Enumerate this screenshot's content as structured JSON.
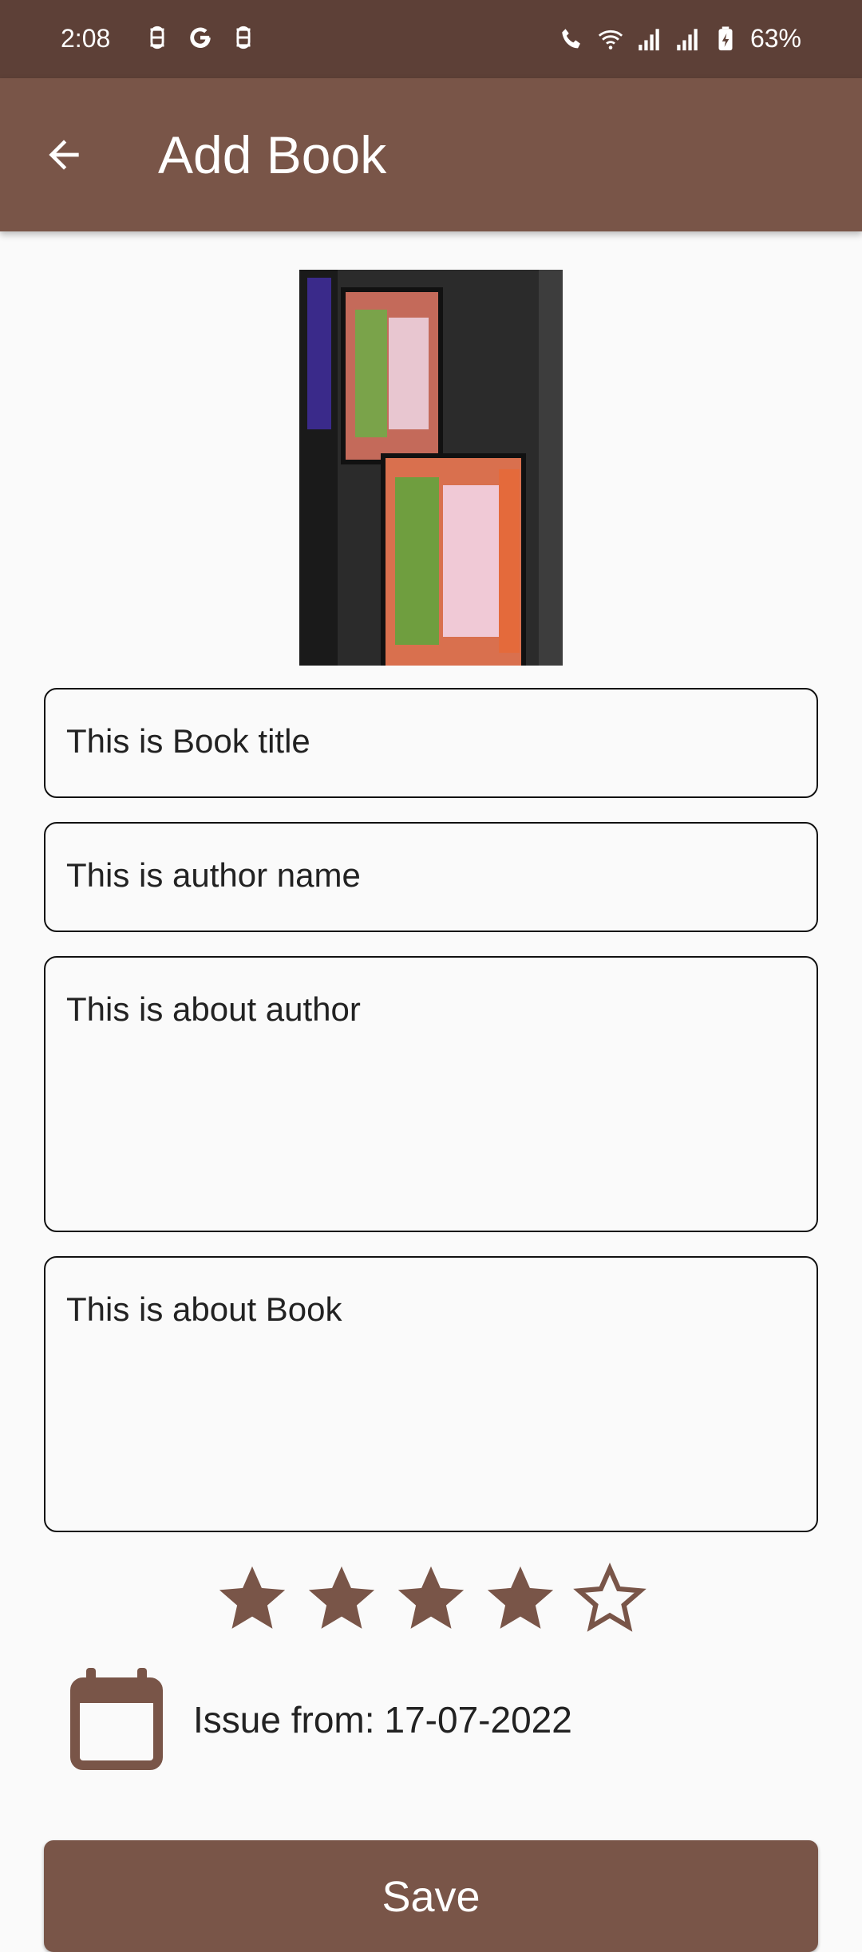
{
  "status_bar": {
    "time": "2:08",
    "battery": "63%",
    "icons": [
      "notification-icon",
      "google-icon",
      "notification-icon",
      "wifi-calling-icon",
      "wifi-icon",
      "signal-icon",
      "signal-icon",
      "battery-charging-icon"
    ]
  },
  "app_bar": {
    "title": "Add Book",
    "back_icon": "arrow-back-icon"
  },
  "form": {
    "book_title": "This is Book title",
    "author_name": "This is author name",
    "about_author": "This is about author",
    "about_book": "This is about Book"
  },
  "rating": {
    "value": 4,
    "max": 5
  },
  "issue": {
    "label": "Issue from:",
    "date": "17-07-2022",
    "icon": "calendar-icon"
  },
  "actions": {
    "save_label": "Save"
  },
  "colors": {
    "status_bar": "#5d4037",
    "primary": "#795548",
    "background": "#fafafa"
  }
}
